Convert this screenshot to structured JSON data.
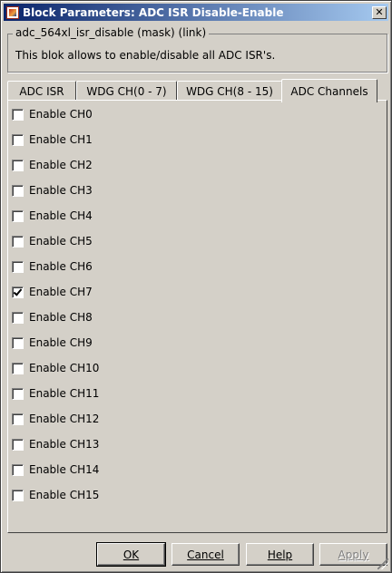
{
  "window": {
    "title": "Block Parameters: ADC ISR Disable-Enable",
    "close_glyph": "✕"
  },
  "mask_group": {
    "legend": "adc_564xl_isr_disable (mask) (link)",
    "description": "This blok allows to enable/disable all ADC ISR's."
  },
  "tabs": [
    {
      "label": "ADC ISR",
      "active": false
    },
    {
      "label": "WDG CH(0 - 7)",
      "active": false
    },
    {
      "label": "WDG CH(8 - 15)",
      "active": false
    },
    {
      "label": "ADC Channels",
      "active": true
    }
  ],
  "channels": [
    {
      "label": "Enable CH0",
      "checked": false
    },
    {
      "label": "Enable CH1",
      "checked": false
    },
    {
      "label": "Enable CH2",
      "checked": false
    },
    {
      "label": "Enable CH3",
      "checked": false
    },
    {
      "label": "Enable CH4",
      "checked": false
    },
    {
      "label": "Enable CH5",
      "checked": false
    },
    {
      "label": "Enable CH6",
      "checked": false
    },
    {
      "label": "Enable CH7",
      "checked": true
    },
    {
      "label": "Enable CH8",
      "checked": false
    },
    {
      "label": "Enable CH9",
      "checked": false
    },
    {
      "label": "Enable CH10",
      "checked": false
    },
    {
      "label": "Enable CH11",
      "checked": false
    },
    {
      "label": "Enable CH12",
      "checked": false
    },
    {
      "label": "Enable CH13",
      "checked": false
    },
    {
      "label": "Enable CH14",
      "checked": false
    },
    {
      "label": "Enable CH15",
      "checked": false
    }
  ],
  "buttons": {
    "ok": "OK",
    "cancel": "Cancel",
    "help": "Help",
    "apply": "Apply"
  }
}
